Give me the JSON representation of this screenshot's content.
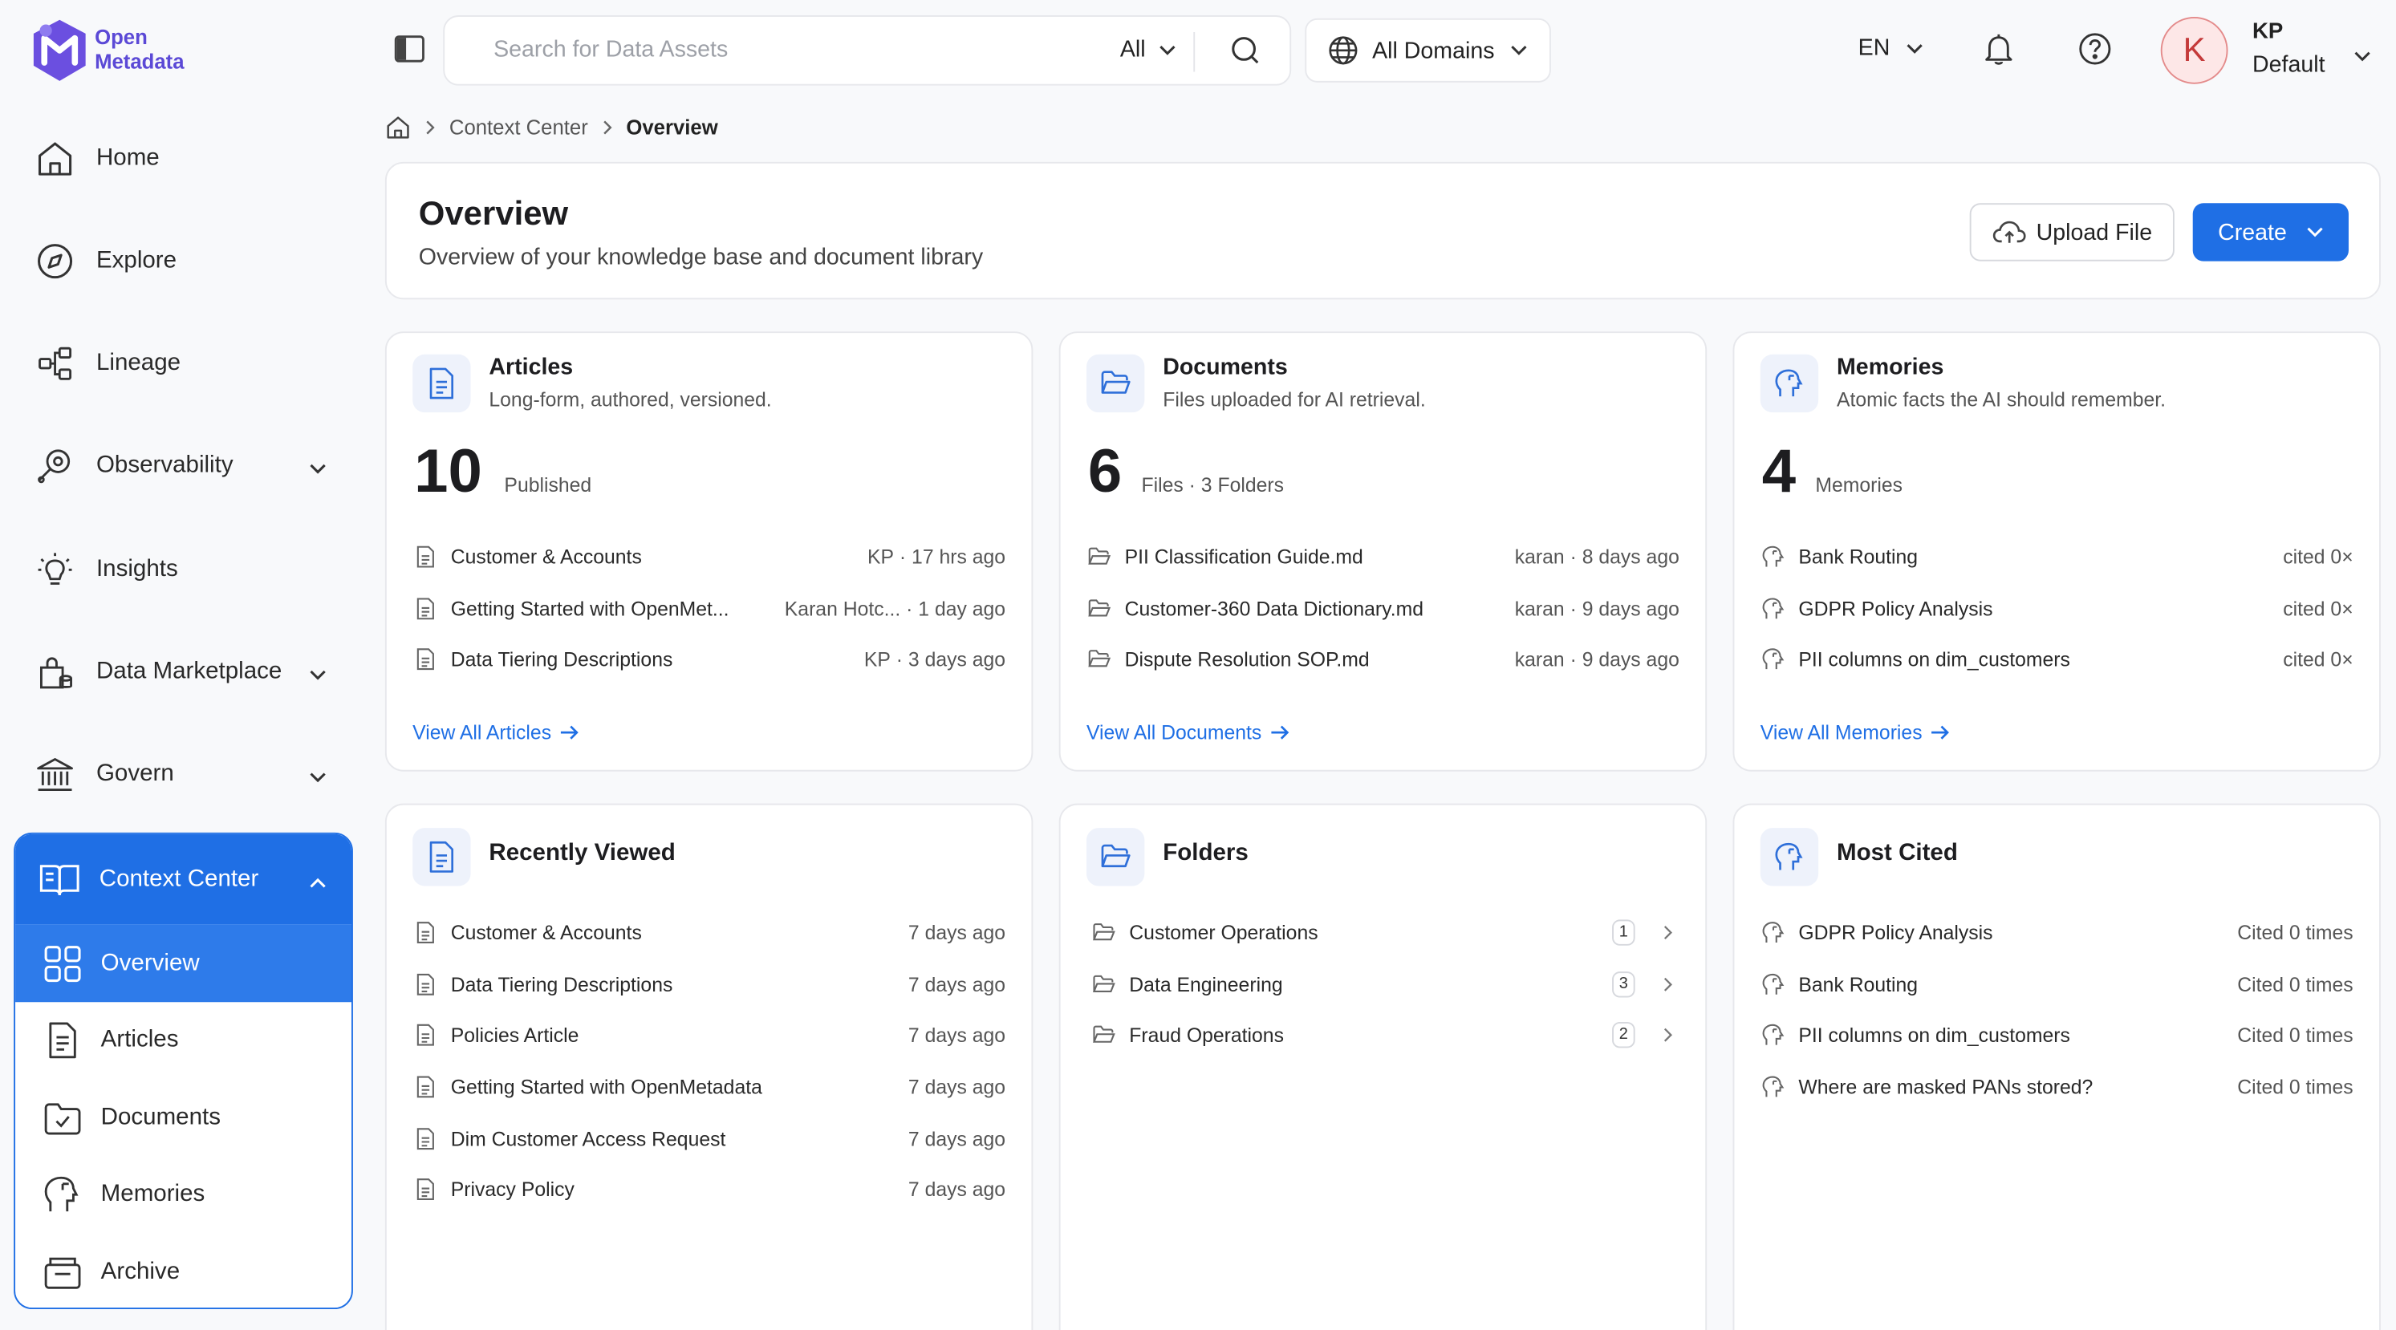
{
  "brand": {
    "line1": "Open",
    "line2": "Metadata",
    "color": "#5b49d6"
  },
  "nav": {
    "items": [
      {
        "label": "Home",
        "icon": "home-icon"
      },
      {
        "label": "Explore",
        "icon": "compass-icon"
      },
      {
        "label": "Lineage",
        "icon": "lineage-icon"
      },
      {
        "label": "Observability",
        "icon": "observability-icon"
      },
      {
        "label": "Insights",
        "icon": "lightbulb-icon"
      },
      {
        "label": "Data Marketplace",
        "icon": "marketplace-icon"
      },
      {
        "label": "Govern",
        "icon": "bank-icon"
      }
    ],
    "context_center": {
      "label": "Context Center",
      "sub_items": [
        {
          "label": "Overview",
          "icon": "grid-icon",
          "active": true
        },
        {
          "label": "Articles",
          "icon": "article-icon"
        },
        {
          "label": "Documents",
          "icon": "folder-check-icon"
        },
        {
          "label": "Memories",
          "icon": "memory-icon"
        },
        {
          "label": "Archive",
          "icon": "archive-icon"
        }
      ]
    }
  },
  "topbar": {
    "search_placeholder": "Search for Data Assets",
    "search_scope": "All",
    "domain": "All Domains",
    "language": "EN",
    "user": {
      "initial": "K",
      "name": "KP",
      "role": "Default"
    }
  },
  "breadcrumb": {
    "parent": "Context Center",
    "current": "Overview"
  },
  "header": {
    "title": "Overview",
    "subtitle": "Overview of your knowledge base and document library",
    "upload_label": "Upload File",
    "create_label": "Create"
  },
  "articles": {
    "title": "Articles",
    "subtitle": "Long-form, authored, versioned.",
    "count": "10",
    "count_label": "Published",
    "items": [
      {
        "name": "Customer & Accounts",
        "author": "KP",
        "time": "17 hrs ago"
      },
      {
        "name": "Getting Started with OpenMet...",
        "author": "Karan Hotc...",
        "time": "1 day ago"
      },
      {
        "name": "Data Tiering Descriptions",
        "author": "KP",
        "time": "3 days ago"
      }
    ],
    "view_all": "View All Articles"
  },
  "documents": {
    "title": "Documents",
    "subtitle": "Files uploaded for AI retrieval.",
    "count": "6",
    "count_label": "Files · 3 Folders",
    "items": [
      {
        "name": "PII Classification Guide.md",
        "author": "karan",
        "time": "8 days ago"
      },
      {
        "name": "Customer-360 Data Dictionary.md",
        "author": "karan",
        "time": "9 days ago"
      },
      {
        "name": "Dispute Resolution SOP.md",
        "author": "karan",
        "time": "9 days ago"
      }
    ],
    "view_all": "View All Documents"
  },
  "memories": {
    "title": "Memories",
    "subtitle": "Atomic facts the AI should remember.",
    "count": "4",
    "count_label": "Memories",
    "items": [
      {
        "name": "Bank Routing",
        "cited": "cited 0×"
      },
      {
        "name": "GDPR Policy Analysis",
        "cited": "cited 0×"
      },
      {
        "name": "PII columns on dim_customers",
        "cited": "cited 0×"
      }
    ],
    "view_all": "View All Memories"
  },
  "recently_viewed": {
    "title": "Recently Viewed",
    "items": [
      {
        "name": "Customer & Accounts",
        "time": "7 days ago"
      },
      {
        "name": "Data Tiering Descriptions",
        "time": "7 days ago"
      },
      {
        "name": "Policies Article",
        "time": "7 days ago"
      },
      {
        "name": "Getting Started with OpenMetadata",
        "time": "7 days ago"
      },
      {
        "name": "Dim Customer Access Request",
        "time": "7 days ago"
      },
      {
        "name": "Privacy Policy",
        "time": "7 days ago"
      }
    ]
  },
  "folders": {
    "title": "Folders",
    "items": [
      {
        "name": "Customer Operations",
        "count": "1"
      },
      {
        "name": "Data Engineering",
        "count": "3"
      },
      {
        "name": "Fraud Operations",
        "count": "2"
      }
    ]
  },
  "most_cited": {
    "title": "Most Cited",
    "items": [
      {
        "name": "GDPR Policy Analysis",
        "cited": "Cited 0 times"
      },
      {
        "name": "Bank Routing",
        "cited": "Cited 0 times"
      },
      {
        "name": "PII columns on dim_customers",
        "cited": "Cited 0 times"
      },
      {
        "name": "Where are masked PANs stored?",
        "cited": "Cited 0 times"
      }
    ]
  },
  "colors": {
    "primary": "#1f6fe5",
    "avatar_bg": "#fde7e7",
    "avatar_text": "#c43a3a"
  }
}
